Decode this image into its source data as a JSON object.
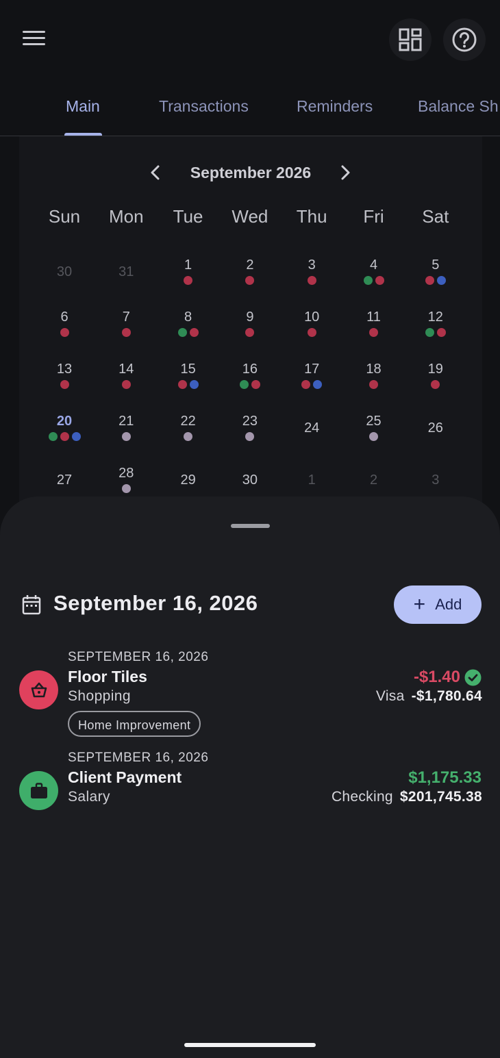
{
  "colors": {
    "background": "#111215",
    "accent": "#a7b3ea",
    "negative": "#d94a64",
    "positive": "#45b06d",
    "dot_red": "#b0334a",
    "dot_green": "#2f8c55",
    "dot_blue": "#3c5fbf",
    "dot_gray": "#a396ac"
  },
  "appbar": {
    "menu_icon": "hamburger-menu-icon",
    "layout_icon": "dashboard-grid-icon",
    "help_icon": "help-circle-icon"
  },
  "tabs": [
    {
      "label": "Main",
      "active": true
    },
    {
      "label": "Transactions",
      "active": false
    },
    {
      "label": "Reminders",
      "active": false
    },
    {
      "label": "Balance Sh",
      "active": false
    }
  ],
  "calendar": {
    "month_label": "September 2026",
    "weekdays": [
      "Sun",
      "Mon",
      "Tue",
      "Wed",
      "Thu",
      "Fri",
      "Sat"
    ],
    "weeks": [
      [
        {
          "n": "30",
          "muted": true,
          "dots": []
        },
        {
          "n": "31",
          "muted": true,
          "dots": []
        },
        {
          "n": "1",
          "dots": [
            "red"
          ]
        },
        {
          "n": "2",
          "dots": [
            "red"
          ]
        },
        {
          "n": "3",
          "dots": [
            "red"
          ]
        },
        {
          "n": "4",
          "dots": [
            "green",
            "red"
          ]
        },
        {
          "n": "5",
          "dots": [
            "red",
            "blue"
          ]
        }
      ],
      [
        {
          "n": "6",
          "dots": [
            "red"
          ]
        },
        {
          "n": "7",
          "dots": [
            "red"
          ]
        },
        {
          "n": "8",
          "dots": [
            "green",
            "red"
          ]
        },
        {
          "n": "9",
          "dots": [
            "red"
          ]
        },
        {
          "n": "10",
          "dots": [
            "red"
          ]
        },
        {
          "n": "11",
          "dots": [
            "red"
          ]
        },
        {
          "n": "12",
          "dots": [
            "green",
            "red"
          ]
        }
      ],
      [
        {
          "n": "13",
          "dots": [
            "red"
          ]
        },
        {
          "n": "14",
          "dots": [
            "red"
          ]
        },
        {
          "n": "15",
          "dots": [
            "red",
            "blue"
          ]
        },
        {
          "n": "16",
          "dots": [
            "green",
            "red"
          ]
        },
        {
          "n": "17",
          "dots": [
            "red",
            "blue"
          ]
        },
        {
          "n": "18",
          "dots": [
            "red"
          ]
        },
        {
          "n": "19",
          "dots": [
            "red"
          ]
        }
      ],
      [
        {
          "n": "20",
          "today": true,
          "dots": [
            "green",
            "red",
            "blue"
          ]
        },
        {
          "n": "21",
          "dots": [
            "gray"
          ]
        },
        {
          "n": "22",
          "dots": [
            "gray"
          ]
        },
        {
          "n": "23",
          "dots": [
            "gray"
          ]
        },
        {
          "n": "24",
          "dots": []
        },
        {
          "n": "25",
          "dots": [
            "gray"
          ]
        },
        {
          "n": "26",
          "dots": []
        }
      ],
      [
        {
          "n": "27",
          "dots": []
        },
        {
          "n": "28",
          "dots": [
            "gray"
          ]
        },
        {
          "n": "29",
          "dots": []
        },
        {
          "n": "30",
          "dots": []
        },
        {
          "n": "1",
          "muted": true,
          "dots": []
        },
        {
          "n": "2",
          "muted": true,
          "dots": []
        },
        {
          "n": "3",
          "muted": true,
          "dots": []
        }
      ]
    ]
  },
  "sheet": {
    "selected_date": "September 16, 2026",
    "add_label": "Add",
    "transactions": [
      {
        "date": "SEPTEMBER 16, 2026",
        "name": "Floor Tiles",
        "category": "Shopping",
        "tag": "Home Improvement",
        "amount": "-$1.40",
        "type": "expense",
        "cleared": true,
        "account": "Visa",
        "balance": "-$1,780.64",
        "icon": "shopping-basket-icon"
      },
      {
        "date": "SEPTEMBER 16, 2026",
        "name": "Client Payment",
        "category": "Salary",
        "amount": "$1,175.33",
        "type": "income",
        "account": "Checking",
        "balance": "$201,745.38",
        "icon": "briefcase-icon"
      }
    ]
  }
}
